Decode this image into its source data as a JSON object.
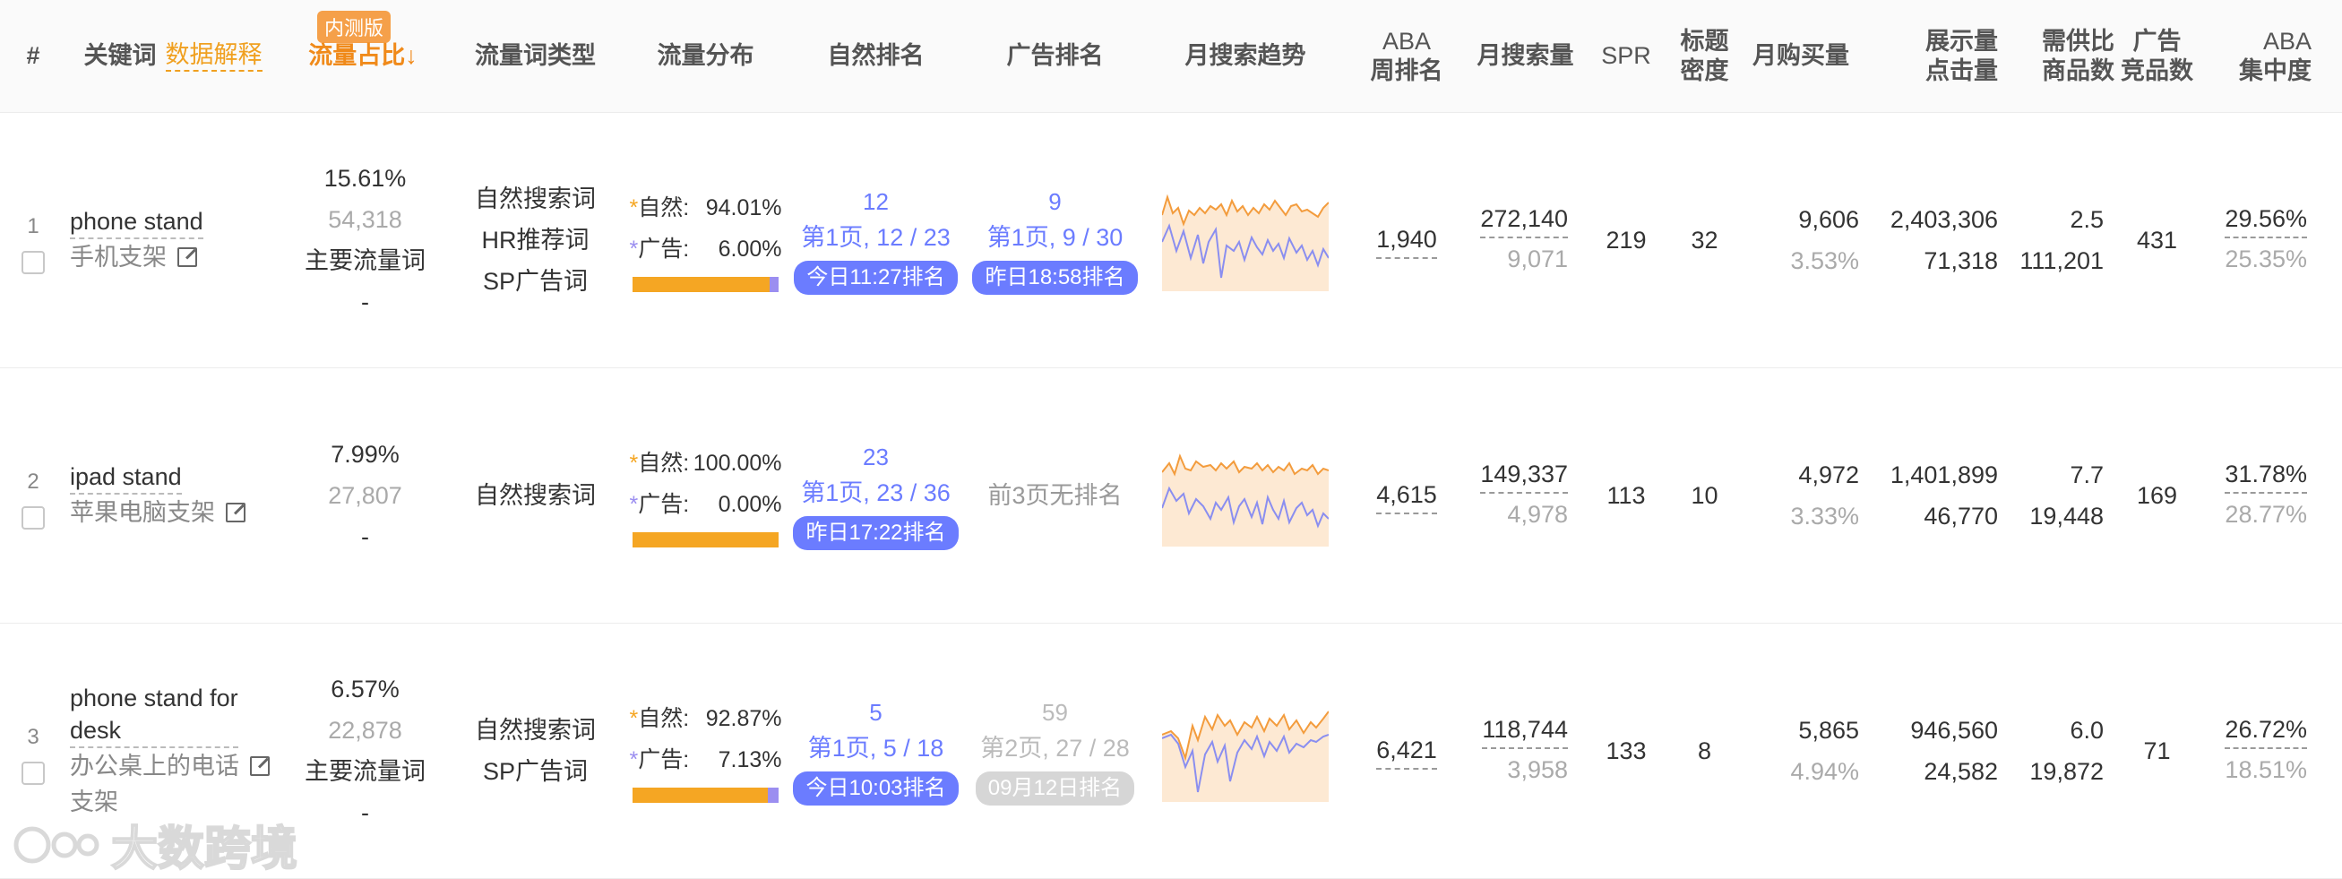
{
  "header": {
    "index": "#",
    "keyword": "关键词",
    "data_explain": "数据解释",
    "beta_badge": "内测版",
    "flow_share": "流量占比↓",
    "flow_type": "流量词类型",
    "flow_dist": "流量分布",
    "natural_rank": "自然排名",
    "ad_rank": "广告排名",
    "search_trend": "月搜索趋势",
    "aba_week_rank_1": "ABA",
    "aba_week_rank_2": "周排名",
    "month_search": "月搜索量",
    "spr": "SPR",
    "title_density_1": "标题",
    "title_density_2": "密度",
    "month_purchase": "月购买量",
    "impressions_1": "展示量",
    "impressions_2": "点击量",
    "supply_1": "需供比",
    "supply_2": "商品数",
    "ad_competitors_1": "广告",
    "ad_competitors_2": "竞品数",
    "aba_conc_1": "ABA",
    "aba_conc_2": "集中度"
  },
  "rows": [
    {
      "index": "1",
      "kw_en": "phone stand",
      "kw_cn": "手机支架",
      "share_pct": "15.61%",
      "share_count": "54,318",
      "share_label": "主要流量词",
      "share_dash": "-",
      "types": [
        "自然搜索词",
        "HR推荐词",
        "SP广告词"
      ],
      "dist_nat_label": "自然:",
      "dist_nat_val": "94.01%",
      "dist_ad_label": "广告:",
      "dist_ad_val": "6.00%",
      "dist_ad_frac": 0.06,
      "nat_num": "12",
      "nat_page": "第1页, 12 / 23",
      "nat_pill": "今日11:27排名",
      "ad_num": "9",
      "ad_page": "第1页, 9 / 30",
      "ad_pill": "昨日18:58排名",
      "aba_rank": "1,940",
      "month_search": "272,140",
      "month_search_sub": "9,071",
      "spr": "219",
      "title_density": "32",
      "purchase": "9,606",
      "purchase_rate": "3.53%",
      "impressions": "2,403,306",
      "clicks": "71,318",
      "supply_ratio": "2.5",
      "product_count": "111,201",
      "ad_competitors": "431",
      "aba_conc": "29.56%",
      "aba_conc_sub": "25.35%"
    },
    {
      "index": "2",
      "kw_en": "ipad stand",
      "kw_cn": "苹果电脑支架",
      "share_pct": "7.99%",
      "share_count": "27,807",
      "share_label": "",
      "share_dash": "-",
      "types": [
        "自然搜索词"
      ],
      "dist_nat_label": "自然:",
      "dist_nat_val": "100.00%",
      "dist_ad_label": "广告:",
      "dist_ad_val": "0.00%",
      "dist_ad_frac": 0.0,
      "nat_num": "23",
      "nat_page": "第1页, 23 / 36",
      "nat_pill": "昨日17:22排名",
      "ad_none": "前3页无排名",
      "aba_rank": "4,615",
      "month_search": "149,337",
      "month_search_sub": "4,978",
      "spr": "113",
      "title_density": "10",
      "purchase": "4,972",
      "purchase_rate": "3.33%",
      "impressions": "1,401,899",
      "clicks": "46,770",
      "supply_ratio": "7.7",
      "product_count": "19,448",
      "ad_competitors": "169",
      "aba_conc": "31.78%",
      "aba_conc_sub": "28.77%"
    },
    {
      "index": "3",
      "kw_en_1": "phone stand for",
      "kw_en_2": "desk",
      "kw_cn_1": "办公桌上的电话",
      "kw_cn_2": "支架",
      "share_pct": "6.57%",
      "share_count": "22,878",
      "share_label": "主要流量词",
      "share_dash": "-",
      "types": [
        "自然搜索词",
        "SP广告词"
      ],
      "dist_nat_label": "自然:",
      "dist_nat_val": "92.87%",
      "dist_ad_label": "广告:",
      "dist_ad_val": "7.13%",
      "dist_ad_frac": 0.0713,
      "nat_num": "5",
      "nat_page": "第1页, 5 / 18",
      "nat_pill": "今日10:03排名",
      "ad_num": "59",
      "ad_page": "第2页, 27 / 28",
      "ad_pill": "09月12日排名",
      "aba_rank": "6,421",
      "month_search": "118,744",
      "month_search_sub": "3,958",
      "spr": "133",
      "title_density": "8",
      "purchase": "5,865",
      "purchase_rate": "4.94%",
      "impressions": "946,560",
      "clicks": "24,582",
      "supply_ratio": "6.0",
      "product_count": "19,872",
      "ad_competitors": "71",
      "aba_conc": "26.72%",
      "aba_conc_sub": "18.51%"
    }
  ],
  "watermark": "大数跨境",
  "colors": {
    "accent_orange": "#f5a623",
    "accent_purple": "#6b7cff",
    "ad_purple": "#9b8ef0"
  }
}
